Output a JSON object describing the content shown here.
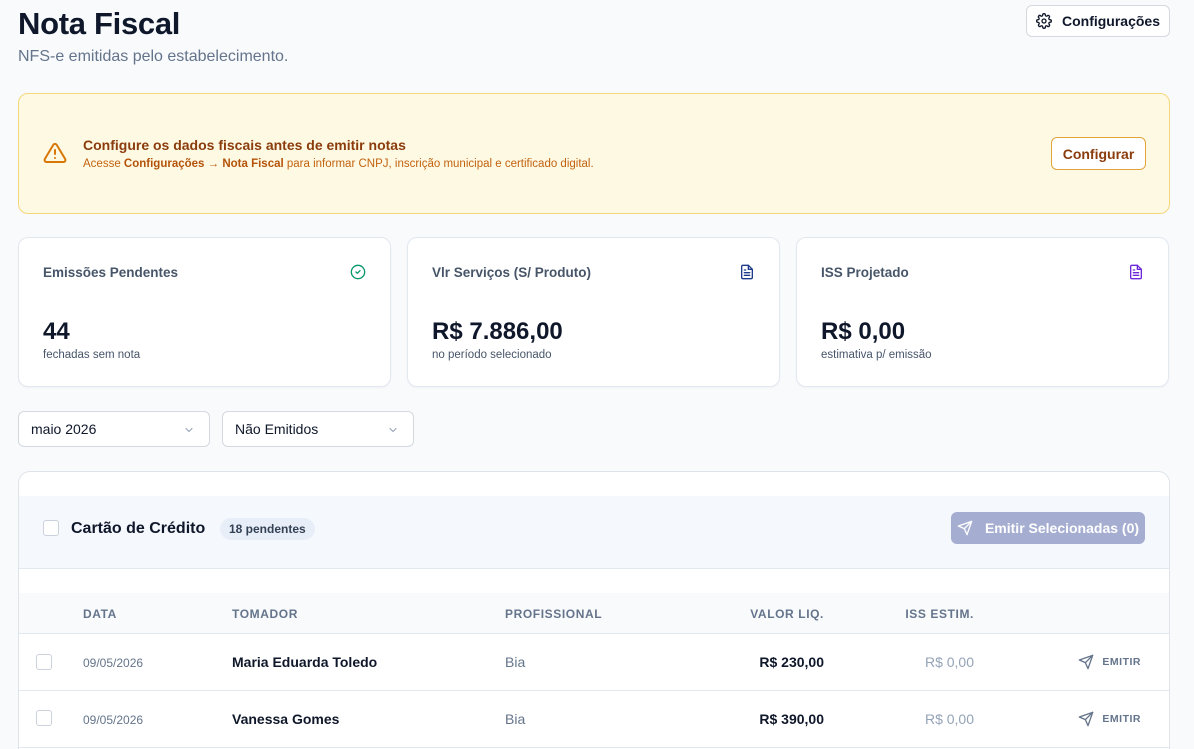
{
  "header": {
    "title": "Nota Fiscal",
    "subtitle": "NFS-e emitidas pelo estabelecimento.",
    "config_button": "Configurações"
  },
  "alert": {
    "title": "Configure os dados fiscais antes de emitir notas",
    "desc_prefix": "Acesse ",
    "desc_path": "Configurações → Nota Fiscal",
    "desc_suffix": " para informar CNPJ, inscrição municipal e certificado digital.",
    "button": "Configurar"
  },
  "kpis": [
    {
      "label": "Emissões Pendentes",
      "value": "44",
      "caption": "fechadas sem nota",
      "icon": "check-circle-icon",
      "icon_color": "#059669"
    },
    {
      "label": "Vlr Serviços (S/ Produto)",
      "value": "R$ 7.886,00",
      "caption": "no período selecionado",
      "icon": "document-icon",
      "icon_color": "#1e3a8a"
    },
    {
      "label": "ISS Projetado",
      "value": "R$ 0,00",
      "caption": "estimativa p/ emissão",
      "icon": "document-icon",
      "icon_color": "#6d28d9"
    }
  ],
  "filters": {
    "period": "maio 2026",
    "status": "Não Emitidos"
  },
  "group": {
    "title": "Cartão de Crédito",
    "badge": "18 pendentes",
    "emit_selected": "Emitir Selecionadas (0)"
  },
  "table": {
    "columns": [
      "DATA",
      "TOMADOR",
      "PROFISSIONAL",
      "VALOR LIQ.",
      "ISS ESTIM."
    ],
    "rows": [
      {
        "date": "09/05/2026",
        "tomador": "Maria Eduarda Toledo",
        "profissional": "Bia",
        "valor": "R$ 230,00",
        "iss": "R$ 0,00",
        "action": "EMITIR"
      },
      {
        "date": "09/05/2026",
        "tomador": "Vanessa Gomes",
        "profissional": "Bia",
        "valor": "R$ 390,00",
        "iss": "R$ 0,00",
        "action": "EMITIR"
      }
    ]
  },
  "colors": {
    "accent_disabled": "#a5aed1",
    "alert_bg": "#fef9e3",
    "alert_border": "#f4d77c",
    "warning": "#d97706"
  }
}
